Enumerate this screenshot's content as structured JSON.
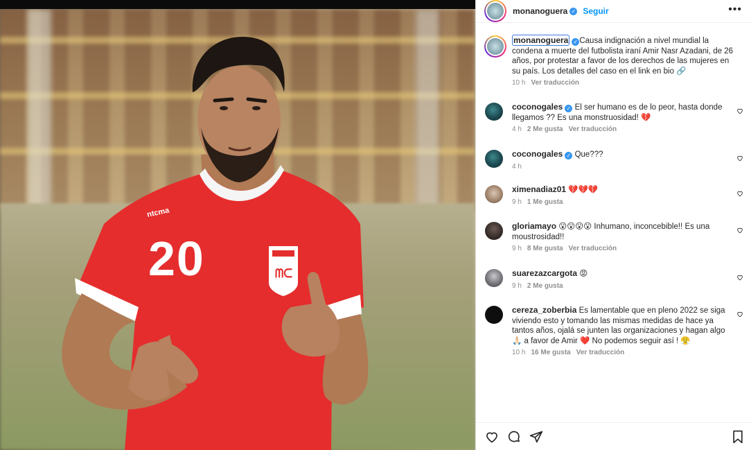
{
  "post": {
    "author": "monanoguera",
    "follow_label": "Seguir",
    "more_label": "•••",
    "jersey_number": "20"
  },
  "caption": {
    "username": "monanoguera",
    "text": "Causa indignación a nivel mundial la condena a muerte del futbolista iraní Amir Nasr Azadani, de 26 años, por protestar a favor de los derechos de las mujeres en su país. Los detalles del caso en el link en bio 🔗",
    "time": "10 h",
    "translate": "Ver traducción"
  },
  "comments": [
    {
      "username": "coconogales",
      "verified": true,
      "text": "El ser humano es de lo peor, hasta donde llegamos ?? Es una monstruosidad! 💔",
      "time": "4 h",
      "likes": "2 Me gusta",
      "translate": "Ver traducción"
    },
    {
      "username": "coconogales",
      "verified": true,
      "text": "Que???",
      "time": "4 h",
      "likes": "",
      "translate": ""
    },
    {
      "username": "ximenadiaz01",
      "verified": false,
      "text": "💔💔💔",
      "time": "9 h",
      "likes": "1 Me gusta",
      "translate": ""
    },
    {
      "username": "gloriamayo",
      "verified": false,
      "text": "😮😮😮😮 Inhumano, inconcebible!! Es una moustrosidad!!",
      "time": "9 h",
      "likes": "8 Me gusta",
      "translate": "Ver traducción"
    },
    {
      "username": "suarezazcargota",
      "verified": false,
      "text": "😡",
      "time": "9 h",
      "likes": "2 Me gusta",
      "translate": ""
    },
    {
      "username": "cereza_zoberbia",
      "verified": false,
      "text": "Es lamentable que en pleno 2022 se siga viviendo esto y tomando las mismas medidas de hace ya tantos años, ojalá se junten las organizaciones y hagan algo 🙏🏻 a favor de Amir ❤️ No podemos seguir así ! 😤",
      "time": "10 h",
      "likes": "16 Me gusta",
      "translate": "Ver traducción"
    }
  ],
  "icons": {
    "like": "heart-icon",
    "comment": "comment-icon",
    "share": "share-icon",
    "save": "bookmark-icon"
  },
  "colors": {
    "link": "#0095f6",
    "verified": "#3897f0",
    "jersey": "#e52d2d",
    "meta": "#8e8e8e"
  }
}
